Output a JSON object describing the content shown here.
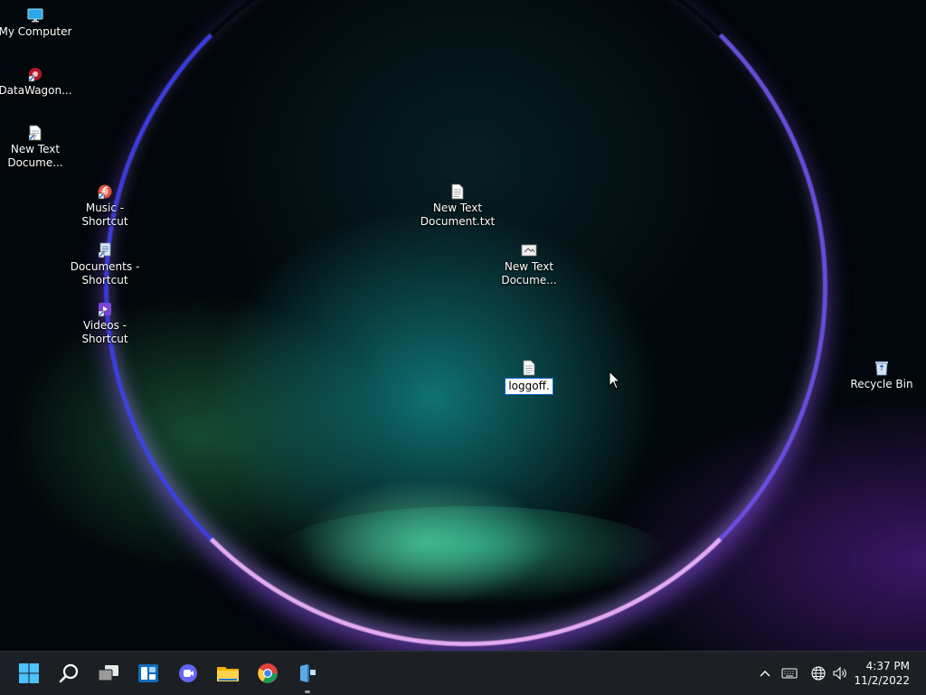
{
  "desktop": {
    "icons": [
      {
        "label": "My Computer"
      },
      {
        "label": "DataWagon..."
      },
      {
        "label": "New Text\nDocume..."
      },
      {
        "label": "Music -\nShortcut"
      },
      {
        "label": "Documents -\nShortcut"
      },
      {
        "label": "Videos -\nShortcut"
      },
      {
        "label": "New Text\nDocument.txt"
      },
      {
        "label": "New Text\nDocume..."
      },
      {
        "label": "Recycle Bin"
      }
    ],
    "rename": {
      "value": "loggoff."
    }
  },
  "taskbar": {
    "apps": [
      {
        "icon": "windows-start-icon"
      },
      {
        "icon": "search-icon"
      },
      {
        "icon": "task-view-icon"
      },
      {
        "icon": "widgets-icon"
      },
      {
        "icon": "chat-icon"
      },
      {
        "icon": "file-explorer-icon"
      },
      {
        "icon": "chrome-icon"
      },
      {
        "icon": "app-running-icon"
      }
    ],
    "tray": {
      "time": "4:37 PM",
      "date": "11/2/2022"
    }
  },
  "colors": {
    "taskbar_bg": "#1c1f24",
    "accent": "#0a64d8"
  }
}
